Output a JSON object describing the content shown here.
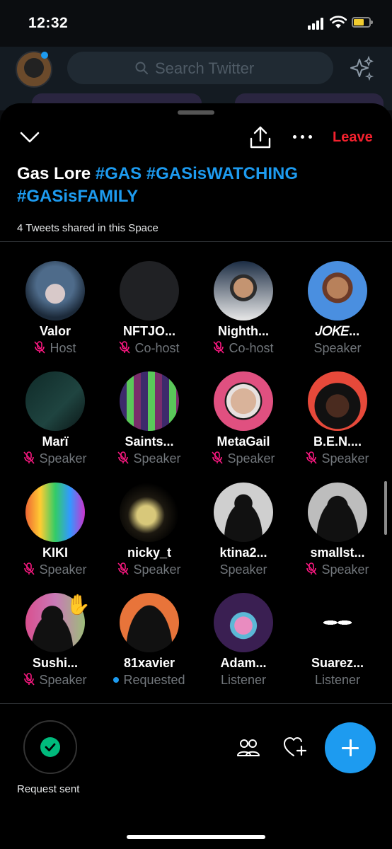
{
  "status_bar": {
    "time": "12:32"
  },
  "background": {
    "search_placeholder": "Search Twitter"
  },
  "space": {
    "leave_label": "Leave",
    "title_parts": [
      "Gas Lore ",
      "#GAS",
      " ",
      "#GASisWATCHING",
      " ",
      "#GASisFAMILY"
    ],
    "tweets_shared": "4 Tweets shared in this Space"
  },
  "participants": [
    {
      "name": "Valor",
      "role": "Host",
      "muted": true,
      "avatar": "octopus-avatar"
    },
    {
      "name": "NFTJO...",
      "role": "Co-host",
      "muted": true,
      "avatar": "blank-avatar"
    },
    {
      "name": "Nighth...",
      "role": "Co-host",
      "muted": true,
      "avatar": "illustrated-man-avatar"
    },
    {
      "name": "𝐽𝑂𝐾𝐸...",
      "role": "Speaker",
      "muted": false,
      "avatar": "anime-character-avatar"
    },
    {
      "name": "Marï",
      "role": "Speaker",
      "muted": true,
      "avatar": "dark-green-avatar"
    },
    {
      "name": "Saints...",
      "role": "Speaker",
      "muted": true,
      "avatar": "pixel-art-avatar"
    },
    {
      "name": "MetaGail",
      "role": "Speaker",
      "muted": true,
      "avatar": "woman-avatar"
    },
    {
      "name": "B.E.N....",
      "role": "Speaker",
      "muted": true,
      "avatar": "curly-hair-man-avatar"
    },
    {
      "name": "KIKI",
      "role": "Speaker",
      "muted": true,
      "avatar": "kiki-logo-avatar"
    },
    {
      "name": "nicky_t",
      "role": "Speaker",
      "muted": true,
      "avatar": "dinosaur-skeleton-avatar"
    },
    {
      "name": "ktina2...",
      "role": "Speaker",
      "muted": false,
      "avatar": "silhouette-avatar"
    },
    {
      "name": "smallst...",
      "role": "Speaker",
      "muted": true,
      "avatar": "spiky-silhouette-avatar"
    },
    {
      "name": "Sushi...",
      "role": "Speaker",
      "muted": true,
      "avatar": "pink-silhouette-avatar",
      "raised_hand": "✋"
    },
    {
      "name": "81xavier",
      "role": "Requested",
      "muted": false,
      "requested": true,
      "avatar": "orange-silhouette-avatar"
    },
    {
      "name": "Adam...",
      "role": "Listener",
      "muted": false,
      "avatar": "bunny-avatar"
    },
    {
      "name": "Suarez...",
      "role": "Listener",
      "muted": false,
      "avatar": "glowing-eyes-avatar"
    }
  ],
  "bottom_bar": {
    "request_label": "Request sent"
  },
  "colors": {
    "accent": "#1d9bf0",
    "leave": "#f4212e",
    "mute": "#f91880",
    "success": "#00ba7c"
  }
}
